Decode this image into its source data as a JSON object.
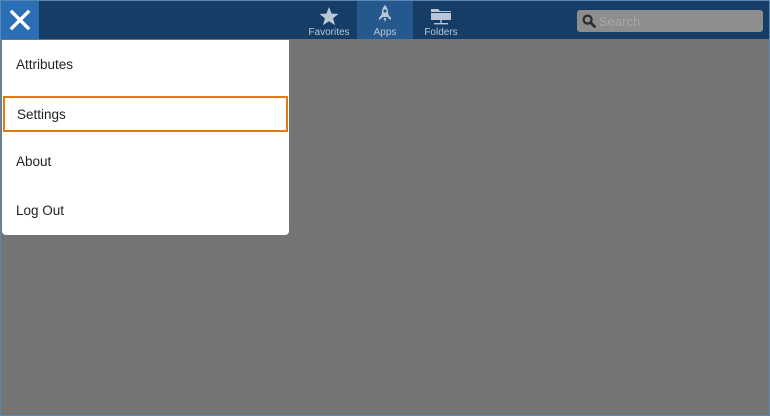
{
  "nav": {
    "items": [
      {
        "label": "Favorites",
        "icon": "star-icon",
        "active": false
      },
      {
        "label": "Apps",
        "icon": "rocket-icon",
        "active": true
      },
      {
        "label": "Folders",
        "icon": "folder-icon",
        "active": false
      }
    ]
  },
  "search": {
    "placeholder": "Search",
    "value": ""
  },
  "menu": {
    "items": [
      {
        "label": "Attributes"
      },
      {
        "label": "Settings",
        "focused": true
      },
      {
        "label": "About"
      },
      {
        "label": "Log Out"
      }
    ]
  },
  "colors": {
    "topbar": "#163d66",
    "close_button": "#2a6fb5",
    "active_nav": "#25598d",
    "overlay": "#747474",
    "focus_outline": "#e07b17"
  }
}
